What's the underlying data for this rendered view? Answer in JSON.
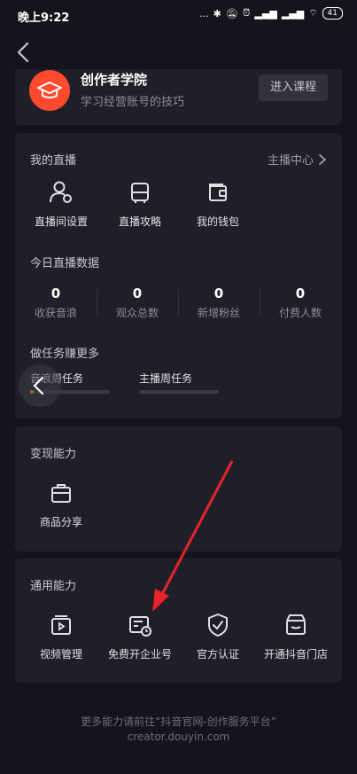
{
  "status_bar": {
    "time": "晚上9:22",
    "dots": "...",
    "signal1": "ᵢ",
    "battery": "41"
  },
  "academy": {
    "title": "创作者学院",
    "subtitle": "学习经营账号的技巧",
    "button": "进入课程"
  },
  "live": {
    "title": "我的直播",
    "host_center": "主播中心",
    "items": [
      {
        "label": "直播间设置",
        "icon": "user-settings-icon"
      },
      {
        "label": "直播攻略",
        "icon": "luggage-icon"
      },
      {
        "label": "我的钱包",
        "icon": "wallet-icon"
      }
    ],
    "stats_title": "今日直播数据",
    "stats": [
      {
        "value": "0",
        "label": "收获音浪"
      },
      {
        "value": "0",
        "label": "观众总数"
      },
      {
        "value": "0",
        "label": "新增粉丝"
      },
      {
        "value": "0",
        "label": "付费人数"
      }
    ],
    "tasks_title": "做任务赚更多",
    "tasks": [
      {
        "label": "音浪周任务",
        "progress": 0.05
      },
      {
        "label": "主播周任务",
        "progress": 0
      }
    ]
  },
  "monetize": {
    "title": "变现能力",
    "items": [
      {
        "label": "商品分享",
        "icon": "shopping-bag-icon"
      }
    ]
  },
  "general": {
    "title": "通用能力",
    "items": [
      {
        "label": "视频管理",
        "icon": "video-manage-icon"
      },
      {
        "label": "免费开企业号",
        "icon": "enterprise-account-icon"
      },
      {
        "label": "官方认证",
        "icon": "verified-shield-icon"
      },
      {
        "label": "开通抖音门店",
        "icon": "store-icon"
      }
    ]
  },
  "footer": {
    "line1": "更多能力请前往“抖音官网-创作服务平台”",
    "line2": "creator.douyin.com"
  },
  "colors": {
    "background": "#14141c",
    "card": "#1f1f29",
    "accent": "#ff4a2e",
    "annotation_arrow": "#e8232a"
  }
}
